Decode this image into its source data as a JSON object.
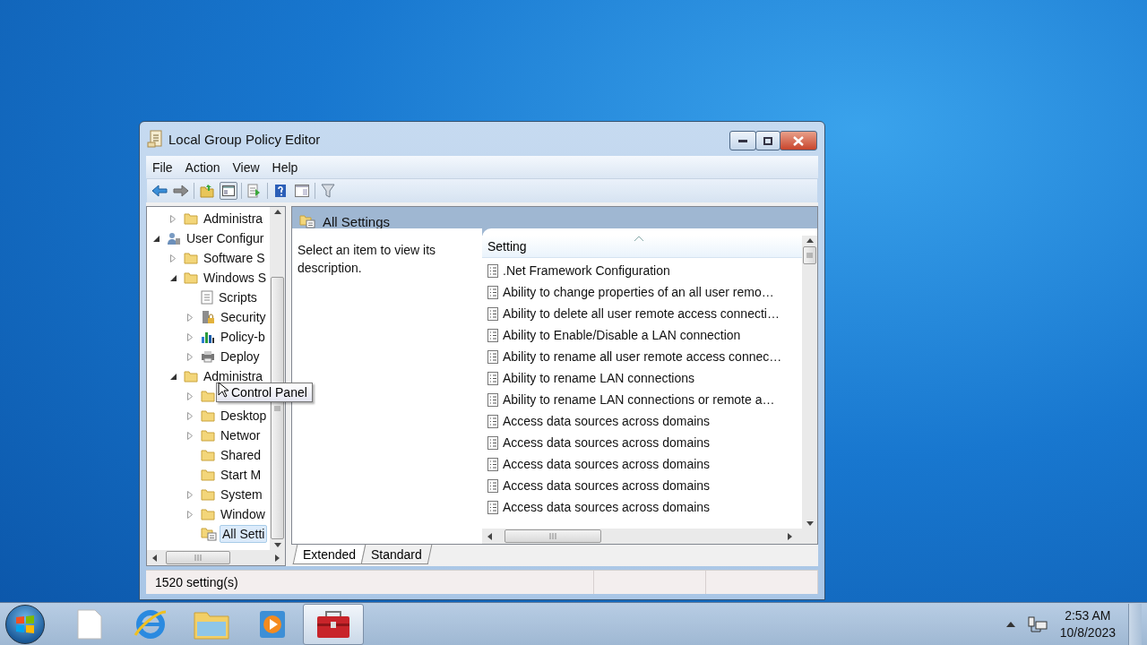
{
  "window": {
    "title": "Local Group Policy Editor"
  },
  "menu": [
    "File",
    "Action",
    "View",
    "Help"
  ],
  "toolbar": [
    {
      "kind": "back"
    },
    {
      "kind": "forward"
    },
    {
      "kind": "sep"
    },
    {
      "kind": "up"
    },
    {
      "kind": "tree",
      "selected": true
    },
    {
      "kind": "sep"
    },
    {
      "kind": "export"
    },
    {
      "kind": "sep"
    },
    {
      "kind": "help"
    },
    {
      "kind": "pane"
    },
    {
      "kind": "sep"
    },
    {
      "kind": "filter"
    }
  ],
  "tree": {
    "items": [
      {
        "label": "Administra",
        "kind": "folder",
        "expanded": false,
        "selected": false,
        "continued": true
      },
      {
        "label": "User Configur",
        "kind": "user",
        "expanded": true,
        "selected": false,
        "children": [
          {
            "label": "Software S",
            "kind": "folder",
            "expanded": false,
            "selected": false
          },
          {
            "label": "Windows S",
            "kind": "folder",
            "expanded": true,
            "selected": false,
            "children": [
              {
                "label": "Scripts",
                "kind": "script",
                "selected": false
              },
              {
                "label": "Security",
                "kind": "security",
                "expanded": false,
                "selected": false
              },
              {
                "label": "Policy-b",
                "kind": "chart",
                "expanded": false,
                "selected": false
              },
              {
                "label": "Deploy",
                "kind": "printer",
                "expanded": false,
                "selected": false
              }
            ]
          },
          {
            "label": "Administra",
            "kind": "folder",
            "expanded": true,
            "selected": false,
            "children": [
              {
                "kind": "folder",
                "expanded": false
              },
              {
                "label": "Desktop",
                "kind": "folder",
                "expanded": false,
                "selected": false
              },
              {
                "label": "Networ",
                "kind": "folder",
                "expanded": false,
                "selected": false
              },
              {
                "label": "Shared",
                "kind": "folder",
                "selected": false
              },
              {
                "label": "Start M",
                "kind": "folder",
                "selected": false
              },
              {
                "label": "System",
                "kind": "folder",
                "expanded": false,
                "selected": false
              },
              {
                "label": "Window",
                "kind": "folder",
                "expanded": false,
                "selected": false
              },
              {
                "label": "All Setti",
                "kind": "settings",
                "selected": true
              }
            ]
          }
        ]
      }
    ]
  },
  "tooltip": "Control Panel",
  "details": {
    "title": "All Settings",
    "description": "Select an item to view its description.",
    "column": "Setting",
    "rows": [
      ".Net Framework Configuration",
      "Ability to change properties of an all user remo…",
      "Ability to delete all user remote access connecti…",
      "Ability to Enable/Disable a LAN connection",
      "Ability to rename all user remote access connec…",
      "Ability to rename LAN connections",
      "Ability to rename LAN connections or remote a…",
      "Access data sources across domains",
      "Access data sources across domains",
      "Access data sources across domains",
      "Access data sources across domains",
      "Access data sources across domains"
    ]
  },
  "tabs": [
    {
      "label": "Extended",
      "selected": true
    },
    {
      "label": "Standard",
      "selected": false
    }
  ],
  "status_bar": "1520 setting(s)",
  "taskbar": {
    "apps": [
      {
        "kind": "file",
        "selected": false
      },
      {
        "kind": "browser",
        "selected": false
      },
      {
        "kind": "explorer",
        "selected": false
      },
      {
        "kind": "media",
        "selected": false
      },
      {
        "kind": "toolbox",
        "selected": true
      }
    ],
    "time": "2:53 AM",
    "date": "10/8/2023"
  }
}
